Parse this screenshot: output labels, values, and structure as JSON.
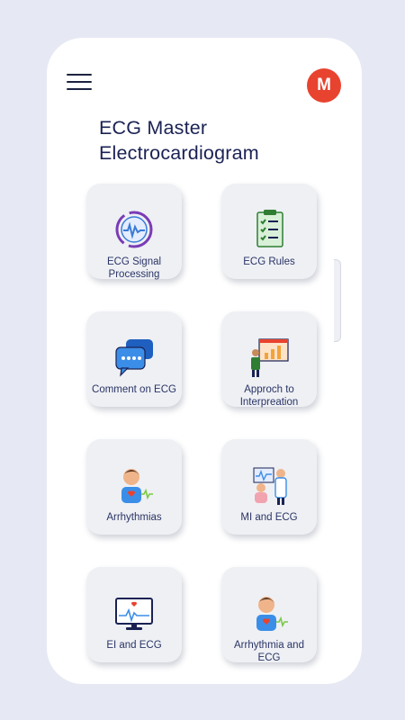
{
  "header": {
    "menu_icon": "hamburger-menu-icon",
    "avatar_letter": "M",
    "avatar_color": "#e8432f"
  },
  "title": {
    "line1": "ECG Master",
    "line2": "Electrocardiogram"
  },
  "colors": {
    "background": "#e6e9f3",
    "title": "#1a2253",
    "card": "#eef0f4",
    "card_label": "#2b3466"
  },
  "cards": [
    {
      "label": "ECG Signal Processing",
      "icon": "signal-processing-icon"
    },
    {
      "label": "ECG Rules",
      "icon": "checklist-icon"
    },
    {
      "label": "Comment on ECG",
      "icon": "chat-bubbles-icon"
    },
    {
      "label": "Approch to Interpreation",
      "icon": "presentation-icon"
    },
    {
      "label": "Arrhythmias",
      "icon": "patient-heart-icon"
    },
    {
      "label": "MI and ECG",
      "icon": "doctor-patient-icon"
    },
    {
      "label": "EI and ECG",
      "icon": "ecg-monitor-icon"
    },
    {
      "label": "Arrhythmia and ECG",
      "icon": "patient-heart-icon"
    }
  ]
}
